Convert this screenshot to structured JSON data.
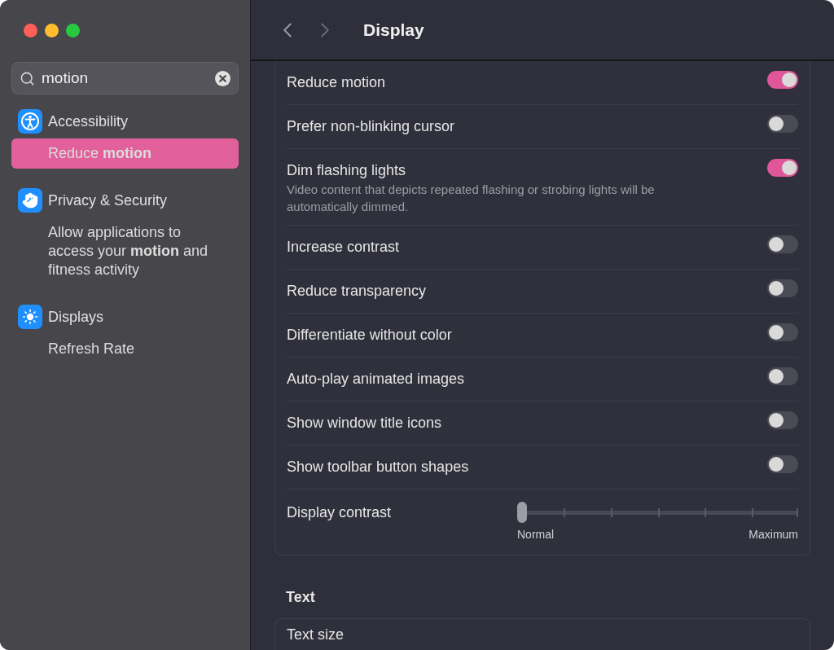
{
  "window": {
    "title": "Display"
  },
  "search": {
    "value": "motion"
  },
  "sidebar": {
    "groups": [
      {
        "title": "Accessibility",
        "items": [
          {
            "label": "Reduce **motion**",
            "selected": true
          }
        ]
      },
      {
        "title": "Privacy & Security",
        "items": [
          {
            "label": "Allow applications to access your **motion** and fitness activity",
            "selected": false
          }
        ]
      },
      {
        "title": "Displays",
        "items": [
          {
            "label": "Refresh Rate",
            "selected": false
          }
        ]
      }
    ]
  },
  "settings": [
    {
      "kind": "toggle",
      "label": "Reduce motion",
      "on": true
    },
    {
      "kind": "toggle",
      "label": "Prefer non-blinking cursor",
      "on": false
    },
    {
      "kind": "toggle",
      "label": "Dim flashing lights",
      "description": "Video content that depicts repeated flashing or strobing lights will be automatically dimmed.",
      "on": true
    },
    {
      "kind": "toggle",
      "label": "Increase contrast",
      "on": false
    },
    {
      "kind": "toggle",
      "label": "Reduce transparency",
      "on": false
    },
    {
      "kind": "toggle",
      "label": "Differentiate without color",
      "on": false
    },
    {
      "kind": "toggle",
      "label": "Auto-play animated images",
      "on": false
    },
    {
      "kind": "toggle",
      "label": "Show window title icons",
      "on": false
    },
    {
      "kind": "toggle",
      "label": "Show toolbar button shapes",
      "on": false
    },
    {
      "kind": "slider",
      "label": "Display contrast",
      "level": 0,
      "min_label": "Normal",
      "max_label": "Maximum"
    }
  ],
  "text_section": {
    "heading": "Text",
    "rows": [
      {
        "label": "Text size"
      }
    ]
  }
}
